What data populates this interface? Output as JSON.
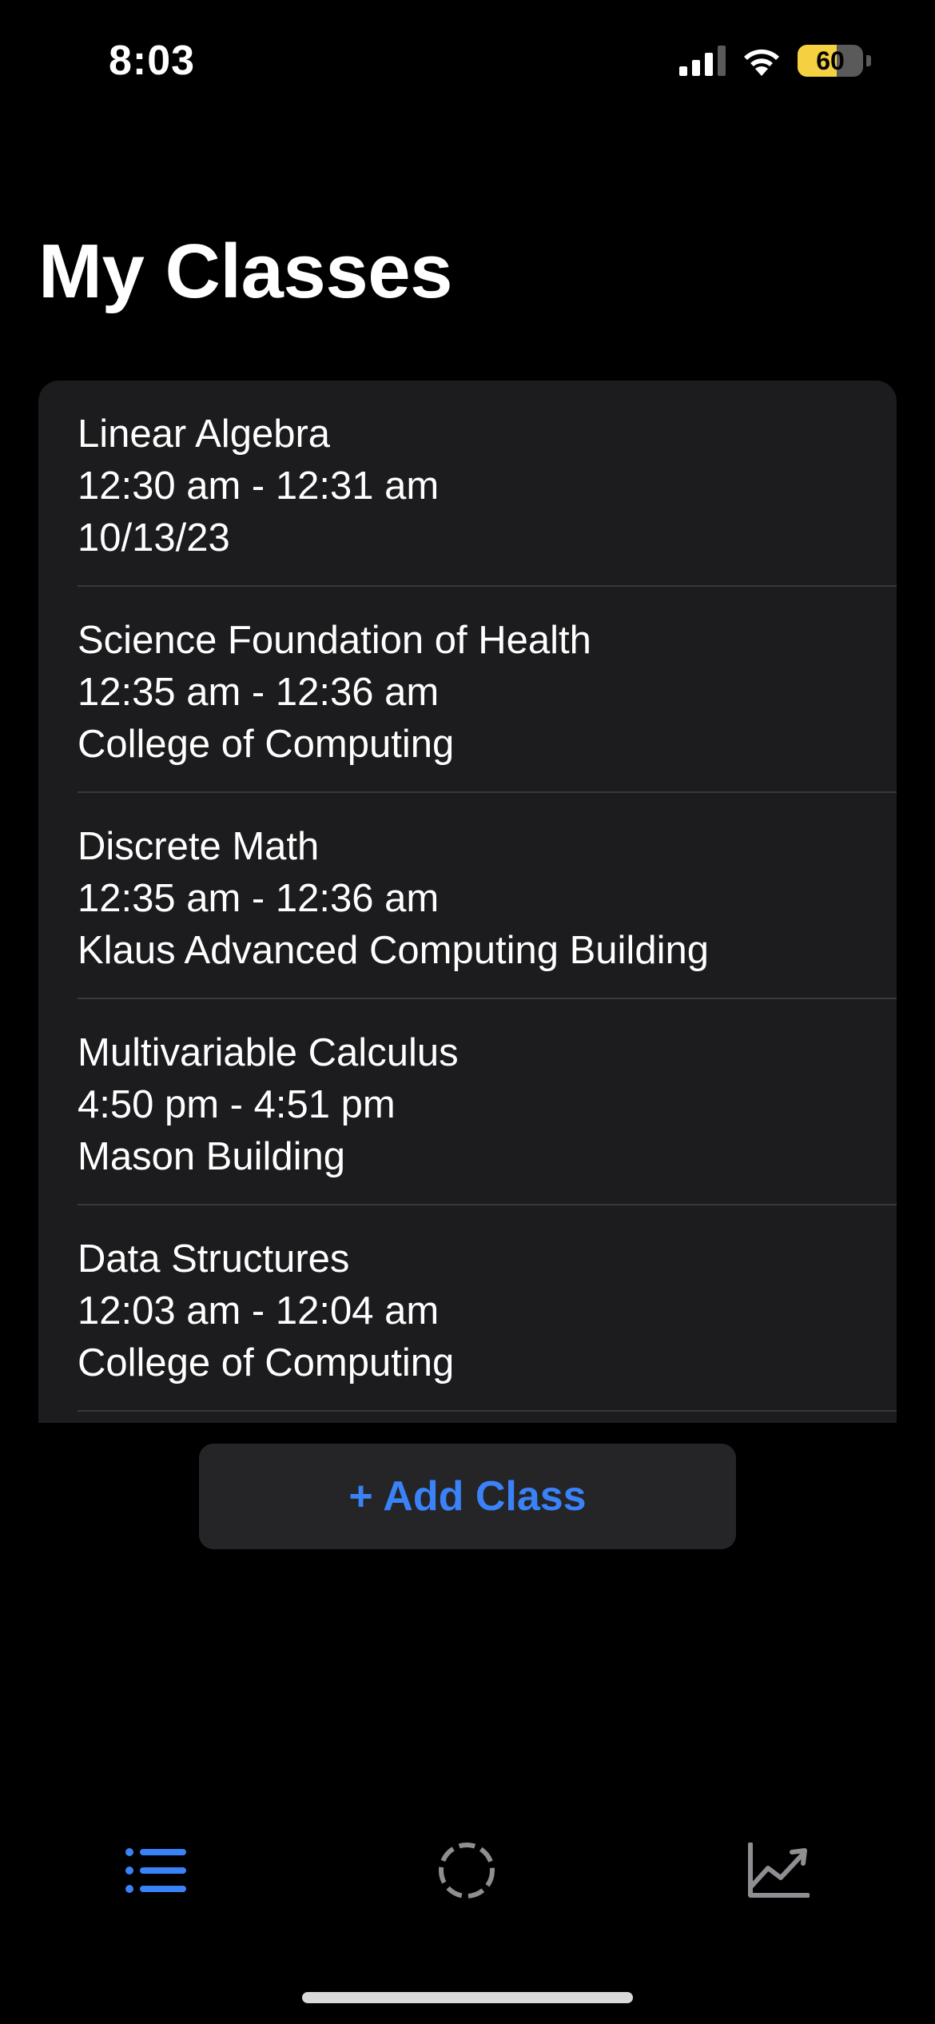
{
  "status_bar": {
    "time": "8:03",
    "battery_level": "60",
    "signal_icon": "cellular-signal-icon",
    "wifi_icon": "wifi-icon",
    "battery_color": "#f5d141"
  },
  "page": {
    "title": "My Classes"
  },
  "classes": [
    {
      "name": "Linear Algebra",
      "time": "12:30 am - 12:31 am",
      "detail": "10/13/23"
    },
    {
      "name": "Science Foundation of Health",
      "time": "12:35 am - 12:36 am",
      "detail": "College of Computing"
    },
    {
      "name": "Discrete Math",
      "time": "12:35 am - 12:36 am",
      "detail": "Klaus Advanced Computing Building"
    },
    {
      "name": "Multivariable Calculus",
      "time": "4:50 pm - 4:51 pm",
      "detail": "Mason Building"
    },
    {
      "name": "Data Structures",
      "time": "12:03 am - 12:04 am",
      "detail": "College of Computing"
    }
  ],
  "actions": {
    "add_class_label": "+ Add Class"
  },
  "tab_bar": {
    "tabs": [
      {
        "icon": "list-icon",
        "active": true
      },
      {
        "icon": "dashed-circle-icon",
        "active": false
      },
      {
        "icon": "chart-line-icon",
        "active": false
      }
    ],
    "active_color": "#3a82f7",
    "inactive_color": "#8e8e93"
  },
  "colors": {
    "background": "#000000",
    "list_background": "#1c1c1e",
    "accent": "#3a82f7"
  }
}
